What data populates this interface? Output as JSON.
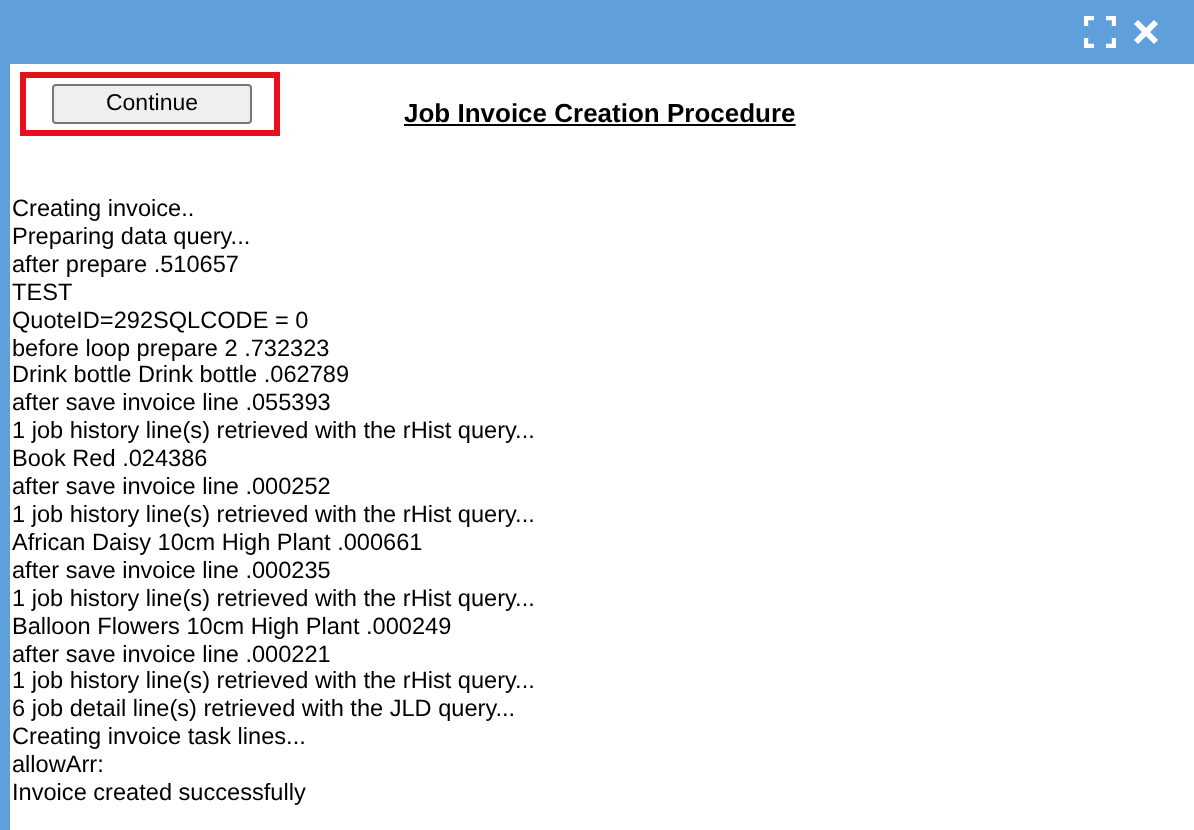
{
  "button": {
    "label": "Continue",
    "highlighted": true
  },
  "title": "Job Invoice Creation Procedure",
  "log": [
    "Creating invoice..",
    "Preparing data query...",
    "after prepare .510657",
    "TEST",
    "QuoteID=292SQLCODE = 0",
    "before loop prepare 2 .732323",
    "Drink bottle Drink bottle .062789",
    "after save invoice line .055393",
    "1 job history line(s) retrieved with the rHist query...",
    "Book Red .024386",
    "after save invoice line .000252",
    "1 job history line(s) retrieved with the rHist query...",
    "African Daisy 10cm High Plant .000661",
    "after save invoice line .000235",
    "1 job history line(s) retrieved with the rHist query...",
    "Balloon Flowers 10cm High Plant .000249",
    "after save invoice line .000221",
    "1 job history line(s) retrieved with the rHist query...",
    "6 job detail line(s) retrieved with the JLD query...",
    "Creating invoice task lines...",
    "allowArr:",
    "Invoice created successfully"
  ]
}
